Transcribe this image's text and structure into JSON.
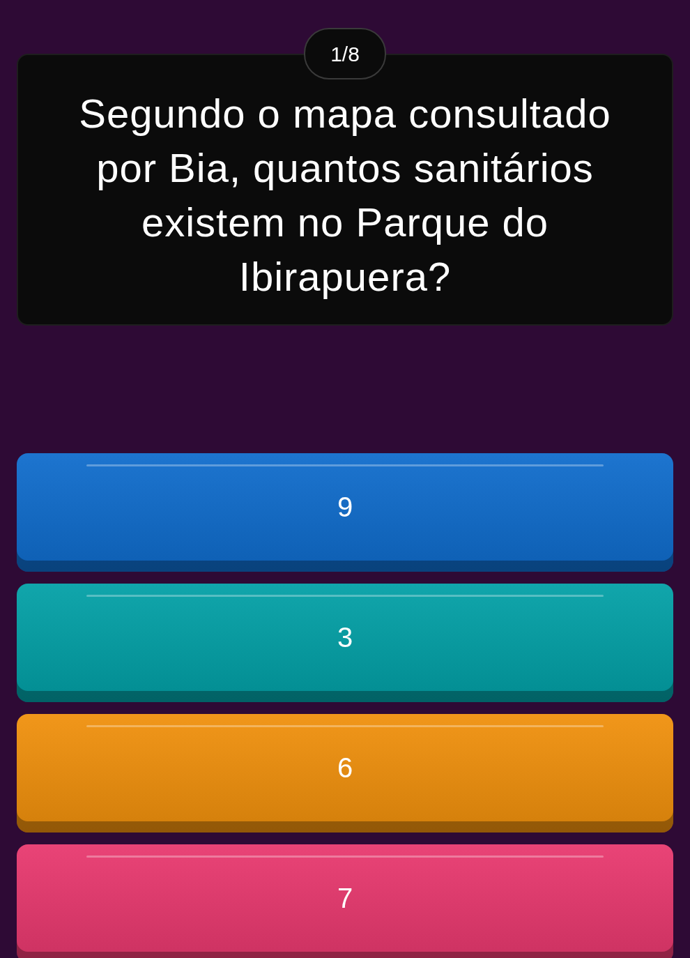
{
  "counter": "1/8",
  "question": "Segundo o mapa consultado por Bia, quantos sanitários existem no Parque do Ibirapuera?",
  "answers": [
    {
      "label": "9",
      "color": "#0f6ccc"
    },
    {
      "label": "3",
      "color": "#02a0a6"
    },
    {
      "label": "6",
      "color": "#f0900c"
    },
    {
      "label": "7",
      "color": "#e8386e"
    }
  ]
}
